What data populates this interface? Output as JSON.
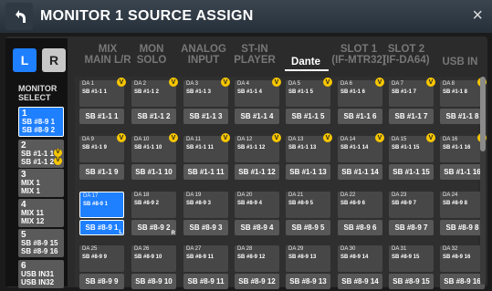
{
  "header": {
    "title": "MONITOR 1 SOURCE ASSIGN",
    "close": "×"
  },
  "lr": {
    "l": "L",
    "r": "R"
  },
  "monitor_select": {
    "line1": "MONITOR",
    "line2": "SELECT"
  },
  "selects": [
    {
      "num": "1",
      "l1": "SB #8-9 1",
      "l2": "SB #8-9 2",
      "active": true
    },
    {
      "num": "2",
      "l1": "SB #1-1 1",
      "l2": "SB #1-1 2",
      "v": true
    },
    {
      "num": "3",
      "l1": "MIX 1",
      "l2": "MIX 1"
    },
    {
      "num": "4",
      "l1": "MIX 11",
      "l2": "MIX 12"
    },
    {
      "num": "5",
      "l1": "SB #8-9 15",
      "l2": "SB #8-9 16"
    },
    {
      "num": "6",
      "l1": "USB IN31",
      "l2": "USB IN32"
    }
  ],
  "tabs": [
    {
      "l1": "MIX",
      "l2": "MAIN L/R"
    },
    {
      "l1": "MON",
      "l2": "SOLO"
    },
    {
      "l1": "ANALOG",
      "l2": "INPUT"
    },
    {
      "l1": "ST-IN",
      "l2": "PLAYER"
    },
    {
      "l1": "Dante",
      "l2": "",
      "active": true
    },
    {
      "l1": "SLOT 1",
      "l2": "(IF-MTR32)"
    },
    {
      "l1": "SLOT 2",
      "l2": "(IF-DA64)"
    },
    {
      "l1": "USB IN",
      "l2": ""
    }
  ],
  "channels": [
    {
      "name": "DA 1",
      "sub": "SB #1-1 1",
      "big": "SB #1-1 1",
      "v": true
    },
    {
      "name": "DA 2",
      "sub": "SB #1-1 2",
      "big": "SB #1-1 2",
      "v": true
    },
    {
      "name": "DA 3",
      "sub": "SB #1-1 3",
      "big": "SB #1-1 3",
      "v": true
    },
    {
      "name": "DA 4",
      "sub": "SB #1-1 4",
      "big": "SB #1-1 4",
      "v": true
    },
    {
      "name": "DA 5",
      "sub": "SB #1-1 5",
      "big": "SB #1-1 5",
      "v": true
    },
    {
      "name": "DA 6",
      "sub": "SB #1-1 6",
      "big": "SB #1-1 6",
      "v": true
    },
    {
      "name": "DA 7",
      "sub": "SB #1-1 7",
      "big": "SB #1-1 7",
      "v": true
    },
    {
      "name": "DA 8",
      "sub": "SB #1-1 8",
      "big": "SB #1-1 8",
      "v": true
    },
    {
      "name": "DA 9",
      "sub": "SB #1-1 9",
      "big": "SB #1-1 9",
      "v": true
    },
    {
      "name": "DA 10",
      "sub": "SB #1-1 10",
      "big": "SB #1-1 10",
      "v": true
    },
    {
      "name": "DA 11",
      "sub": "SB #1-1 11",
      "big": "SB #1-1 11",
      "v": true
    },
    {
      "name": "DA 12",
      "sub": "SB #1-1 12",
      "big": "SB #1-1 12",
      "v": true
    },
    {
      "name": "DA 13",
      "sub": "SB #1-1 13",
      "big": "SB #1-1 13",
      "v": true
    },
    {
      "name": "DA 14",
      "sub": "SB #1-1 14",
      "big": "SB #1-1 14",
      "v": true
    },
    {
      "name": "DA 15",
      "sub": "SB #1-1 15",
      "big": "SB #1-1 15",
      "v": true
    },
    {
      "name": "DA 16",
      "sub": "SB #1-1 16",
      "big": "SB #1-1 16",
      "v": true
    },
    {
      "name": "DA 17",
      "sub": "SB #8-9 1",
      "big": "SB #8-9 1",
      "active": true,
      "tag": "L"
    },
    {
      "name": "DA 18",
      "sub": "SB #8-9 2",
      "big": "SB #8-9 2",
      "tag": "R"
    },
    {
      "name": "DA 19",
      "sub": "SB #8-9 3",
      "big": "SB #8-9 3"
    },
    {
      "name": "DA 20",
      "sub": "SB #8-9 4",
      "big": "SB #8-9 4"
    },
    {
      "name": "DA 21",
      "sub": "SB #8-9 5",
      "big": "SB #8-9 5"
    },
    {
      "name": "DA 22",
      "sub": "SB #8-9 6",
      "big": "SB #8-9 6"
    },
    {
      "name": "DA 23",
      "sub": "SB #8-9 7",
      "big": "SB #8-9 7"
    },
    {
      "name": "DA 24",
      "sub": "SB #8-9 8",
      "big": "SB #8-9 8"
    },
    {
      "name": "DA 25",
      "sub": "SB #8-9 9",
      "big": "SB #8-9 9"
    },
    {
      "name": "DA 26",
      "sub": "SB #8-9 10",
      "big": "SB #8-9 10"
    },
    {
      "name": "DA 27",
      "sub": "SB #8-9 11",
      "big": "SB #8-9 11"
    },
    {
      "name": "DA 28",
      "sub": "SB #8-9 12",
      "big": "SB #8-9 12"
    },
    {
      "name": "DA 29",
      "sub": "SB #8-9 13",
      "big": "SB #8-9 13"
    },
    {
      "name": "DA 30",
      "sub": "SB #8-9 14",
      "big": "SB #8-9 14"
    },
    {
      "name": "DA 31",
      "sub": "SB #8-9 15",
      "big": "SB #8-9 15"
    },
    {
      "name": "DA 32",
      "sub": "SB #8-9 16",
      "big": "SB #8-9 16"
    }
  ],
  "v_badge": "V",
  "icons": {
    "back": "back-arrow-icon",
    "close": "close-icon"
  },
  "colors": {
    "accent": "#1e7fff",
    "badge": "#f7c600"
  }
}
